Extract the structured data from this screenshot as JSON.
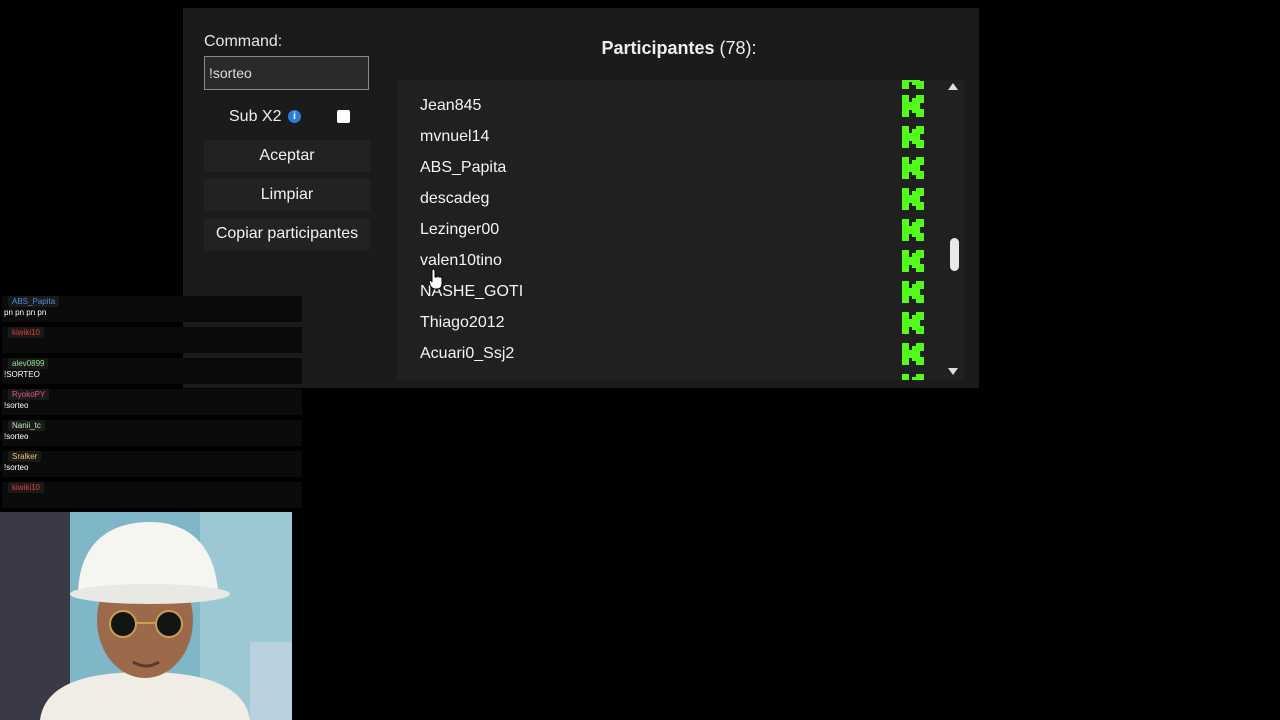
{
  "command": {
    "label": "Command:",
    "value": "!sorteo"
  },
  "subx2": {
    "label": "Sub X2",
    "info_icon": "info-icon",
    "checked": false
  },
  "buttons": {
    "accept": "Aceptar",
    "clear": "Limpiar",
    "copy": "Copiar participantes"
  },
  "participants": {
    "title": "Participantes",
    "count": "(78):",
    "users": [
      "Jean845",
      "mvnuel14",
      "ABS_Papita",
      "descadeg",
      "Lezinger00",
      "valen10tino",
      "NASHE_GOTI",
      "Thiago2012",
      "Acuari0_Ssj2"
    ],
    "platform_icon": "kick-logo-icon",
    "accent": "#53fc18"
  },
  "chat": {
    "messages": [
      {
        "user": "ABS_Papita",
        "text": "pn pn pn pn",
        "color": "#4d8ce0"
      },
      {
        "user": "kiwiki10",
        "text": "",
        "color": "#e23b3b"
      },
      {
        "user": "alev0899",
        "text": "!SORTEO",
        "color": "#8fe08f"
      },
      {
        "user": "RyokoPY",
        "text": "!sorteo",
        "color": "#e05a7a"
      },
      {
        "user": "Nanii_tc",
        "text": "!sorteo",
        "color": "#b8f0a8"
      },
      {
        "user": "Sralker",
        "text": "!sorteo",
        "color": "#f0c070"
      },
      {
        "user": "kiwiki10",
        "text": "",
        "color": "#e23b3b"
      }
    ]
  }
}
